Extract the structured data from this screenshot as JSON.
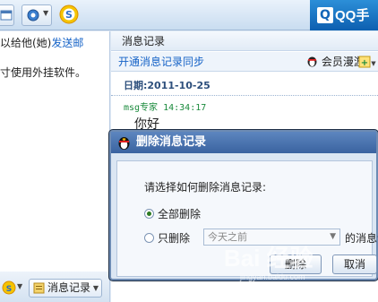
{
  "colors": {
    "accent": "#1663c7",
    "title_bar": "#3a63a0",
    "green_user": "#1a8a3c"
  },
  "toolbar": {
    "icons": [
      "window-icon",
      "gear-icon",
      "sogou-icon"
    ],
    "banner_text": "QQ手"
  },
  "left": {
    "line1_a": "以给他(她)",
    "line1_b": "发送邮",
    "line2": "寸使用外挂软件。"
  },
  "bottom": {
    "msg_record_label": "消息记录"
  },
  "history": {
    "title": "消息记录",
    "sync_link": "开通消息记录同步",
    "roam_label": "会员漫游",
    "date_label": "日期:",
    "date_value": "2011-10-25",
    "sender": "msg专家",
    "time": "14:34:17",
    "message": "你好"
  },
  "dialog": {
    "title": "删除消息记录",
    "prompt": "请选择如何删除消息记录:",
    "option_all": "全部删除",
    "option_only": "只删除",
    "select_value": "今天之前",
    "suffix": "的消息记",
    "ok_label": "删除",
    "cancel_label": "取消"
  },
  "watermark": {
    "main": "Bai 经验",
    "sub": "jingyan.baidu.com"
  }
}
